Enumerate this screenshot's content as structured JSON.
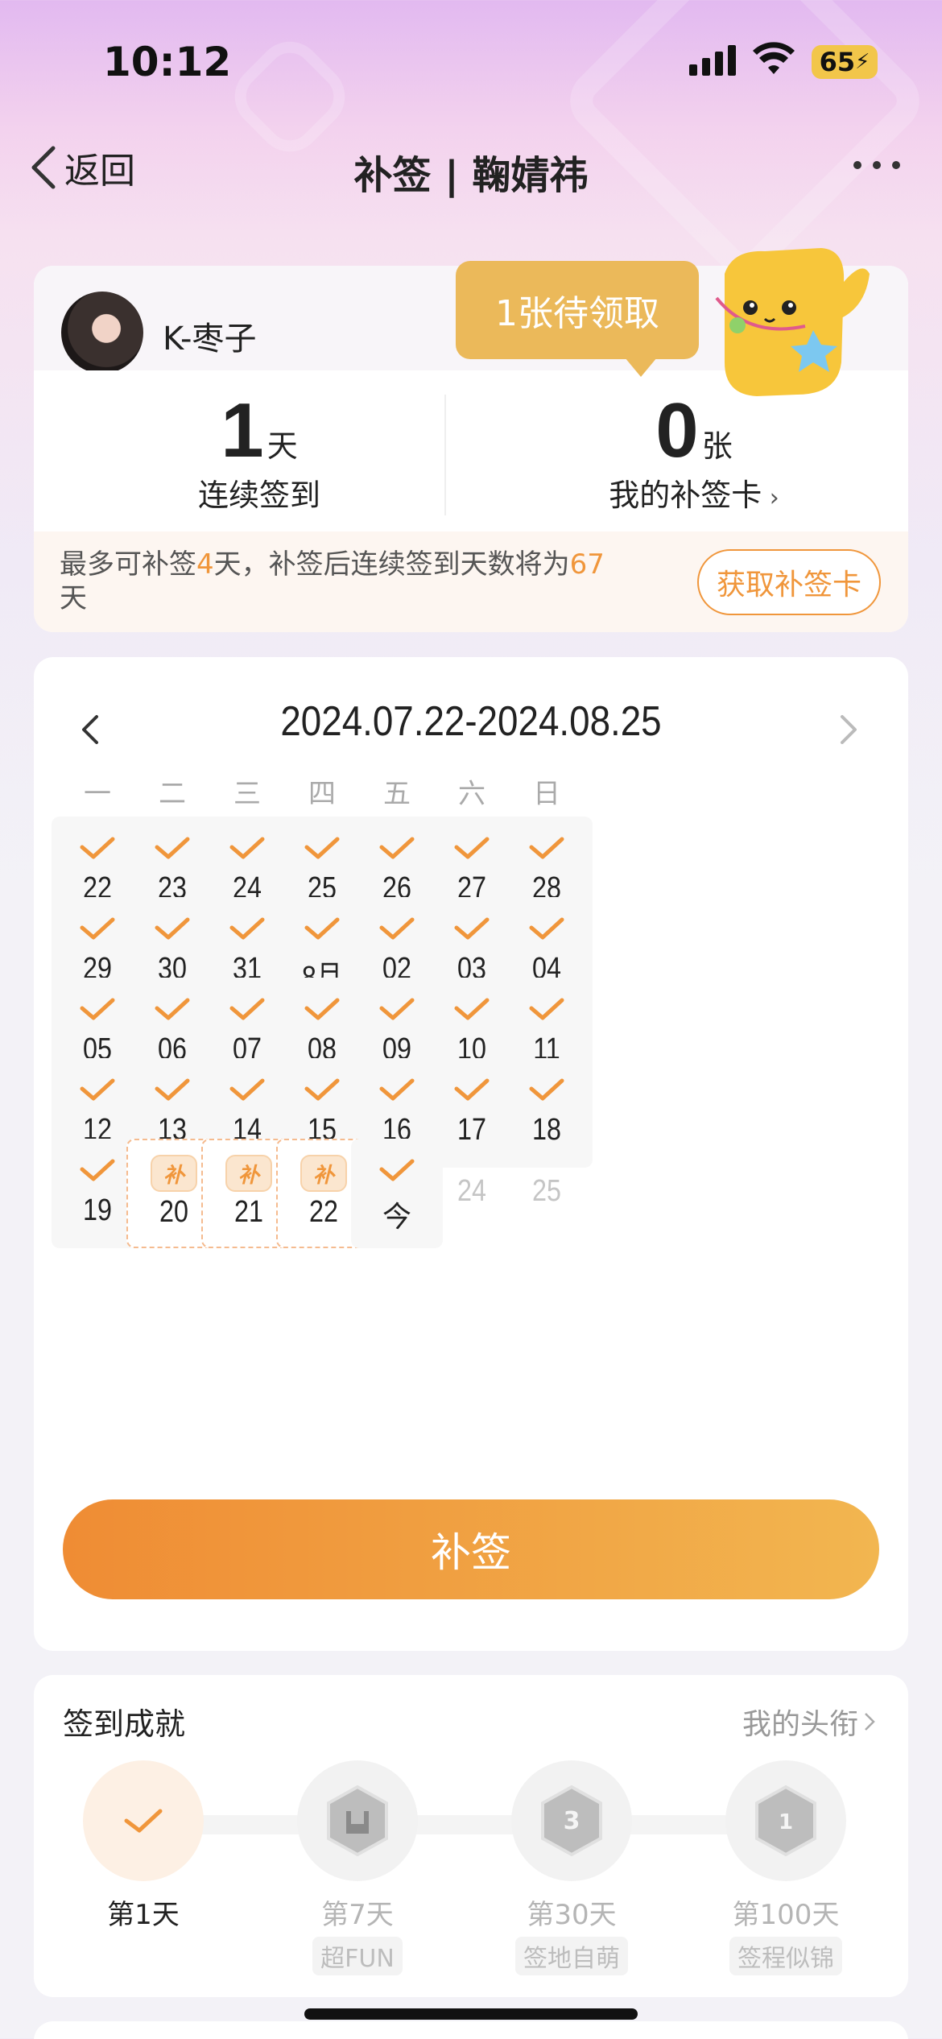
{
  "status_bar": {
    "time": "10:12",
    "battery": "65"
  },
  "nav": {
    "back_label": "返回",
    "title": "补签 | 鞠婧祎"
  },
  "user": {
    "name": "K-枣子"
  },
  "stats": {
    "streak_value": "1",
    "streak_unit": "天",
    "streak_label": "连续签到",
    "cards_value": "0",
    "cards_unit": "张",
    "cards_label": "我的补签卡"
  },
  "pending_bubble": "1张待领取",
  "tip": {
    "part1": "最多可补签",
    "days": "4",
    "part2": "天，补签后连续签到天数将为",
    "total": "67",
    "part3": "天"
  },
  "get_card_button": "获取补签卡",
  "calendar": {
    "range": "2024.07.22-2024.08.25",
    "weekdays": [
      "一",
      "二",
      "三",
      "四",
      "五",
      "六",
      "日"
    ],
    "rows": [
      [
        {
          "label": "22",
          "state": "signed"
        },
        {
          "label": "23",
          "state": "signed"
        },
        {
          "label": "24",
          "state": "signed"
        },
        {
          "label": "25",
          "state": "signed"
        },
        {
          "label": "26",
          "state": "signed"
        },
        {
          "label": "27",
          "state": "signed"
        },
        {
          "label": "28",
          "state": "signed"
        }
      ],
      [
        {
          "label": "29",
          "state": "signed"
        },
        {
          "label": "30",
          "state": "signed"
        },
        {
          "label": "31",
          "state": "signed"
        },
        {
          "label": "8月",
          "state": "signed"
        },
        {
          "label": "02",
          "state": "signed"
        },
        {
          "label": "03",
          "state": "signed"
        },
        {
          "label": "04",
          "state": "signed"
        }
      ],
      [
        {
          "label": "05",
          "state": "signed"
        },
        {
          "label": "06",
          "state": "signed"
        },
        {
          "label": "07",
          "state": "signed"
        },
        {
          "label": "08",
          "state": "signed"
        },
        {
          "label": "09",
          "state": "signed"
        },
        {
          "label": "10",
          "state": "signed"
        },
        {
          "label": "11",
          "state": "signed"
        }
      ],
      [
        {
          "label": "12",
          "state": "signed"
        },
        {
          "label": "13",
          "state": "signed"
        },
        {
          "label": "14",
          "state": "signed"
        },
        {
          "label": "15",
          "state": "signed"
        },
        {
          "label": "16",
          "state": "signed"
        },
        {
          "label": "17",
          "state": "signed"
        },
        {
          "label": "18",
          "state": "signed"
        }
      ],
      [
        {
          "label": "19",
          "state": "signed"
        },
        {
          "label": "20",
          "state": "makeup"
        },
        {
          "label": "21",
          "state": "makeup"
        },
        {
          "label": "22",
          "state": "makeup"
        },
        {
          "label": "今",
          "state": "today"
        },
        {
          "label": "24",
          "state": "future"
        },
        {
          "label": "25",
          "state": "future"
        }
      ]
    ],
    "makeup_tag": "补"
  },
  "makeup_button": "补签",
  "achievements": {
    "title": "签到成就",
    "link": "我的头衔",
    "items": [
      {
        "day": "第1天",
        "sub": "",
        "done": true,
        "icon": "check-icon"
      },
      {
        "day": "第7天",
        "sub": "超FUN",
        "done": false,
        "icon": "rock-hand-badge-icon"
      },
      {
        "day": "第30天",
        "sub": "签地自萌",
        "done": false,
        "icon": "30-days-badge-icon"
      },
      {
        "day": "第100天",
        "sub": "签程似锦",
        "done": false,
        "icon": "100-days-badge-icon"
      }
    ]
  },
  "colors": {
    "accent": "#f0963b",
    "bubble": "#ebb95a"
  }
}
